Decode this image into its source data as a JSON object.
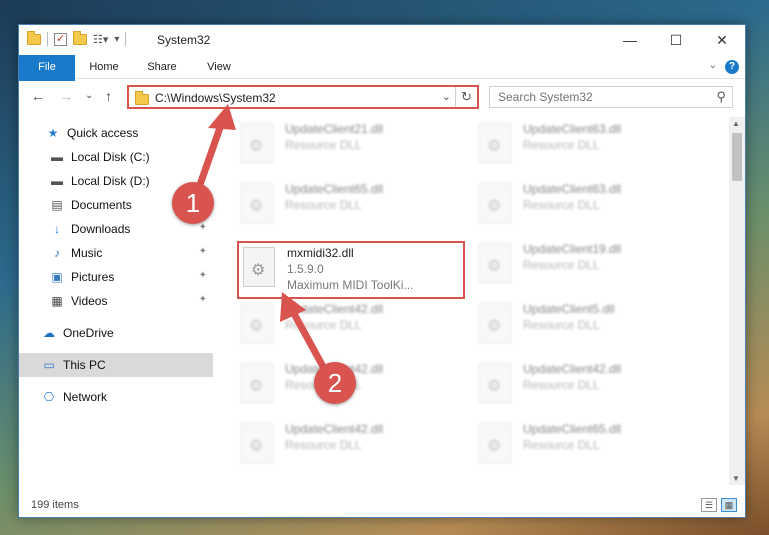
{
  "window": {
    "title": "System32",
    "controls": {
      "minimize": "—",
      "maximize": "☐",
      "close": "✕"
    }
  },
  "ribbon": {
    "tabs": [
      "File",
      "Home",
      "Share",
      "View"
    ],
    "help": "?"
  },
  "address": {
    "path": "C:\\Windows\\System32",
    "search_placeholder": "Search System32"
  },
  "nav": {
    "items": [
      {
        "label": "Quick access",
        "icon": "star-icon",
        "glyph": "★"
      },
      {
        "label": "Local Disk (C:)",
        "icon": "drive-icon",
        "glyph": "▬"
      },
      {
        "label": "Local Disk (D:)",
        "icon": "drive-icon",
        "glyph": "▬"
      },
      {
        "label": "Documents",
        "icon": "document-icon",
        "glyph": "▤"
      },
      {
        "label": "Downloads",
        "icon": "download-icon",
        "glyph": "↓"
      },
      {
        "label": "Music",
        "icon": "music-icon",
        "glyph": "♪"
      },
      {
        "label": "Pictures",
        "icon": "pictures-icon",
        "glyph": "▣"
      },
      {
        "label": "Videos",
        "icon": "video-icon",
        "glyph": "▦"
      },
      {
        "label": "OneDrive",
        "icon": "cloud-icon",
        "glyph": "☁"
      },
      {
        "label": "This PC",
        "icon": "computer-icon",
        "glyph": "▭"
      },
      {
        "label": "Network",
        "icon": "network-icon",
        "glyph": "⎔"
      }
    ]
  },
  "files": [
    {
      "name": "UpdateClient21.dll",
      "type": "Resource DLL"
    },
    {
      "name": "UpdateClient63.dll",
      "type": "Resource DLL"
    },
    {
      "name": "UpdateClient65.dll",
      "type": "Resource DLL"
    },
    {
      "name": "UpdateClient63.dll",
      "type": "Resource DLL"
    },
    {
      "name": "mxmidi32.dll",
      "version": "1.5.9.0",
      "description": "Maximum MIDI ToolKi..."
    },
    {
      "name": "UpdateClient19.dll",
      "type": "Resource DLL"
    },
    {
      "name": "UpdateClient42.dll",
      "type": "Resource DLL"
    },
    {
      "name": "UpdateClient5.dll",
      "type": "Resource DLL"
    },
    {
      "name": "UpdateClient42.dll",
      "type": "Resource DLL"
    },
    {
      "name": "UpdateClient42.dll",
      "type": "Resource DLL"
    },
    {
      "name": "UpdateClient42.dll",
      "type": "Resource DLL"
    },
    {
      "name": "UpdateClient65.dll",
      "type": "Resource DLL"
    }
  ],
  "status": {
    "count": "199 items"
  },
  "annotations": {
    "step1": "1",
    "step2": "2",
    "color": "#d9534f"
  }
}
